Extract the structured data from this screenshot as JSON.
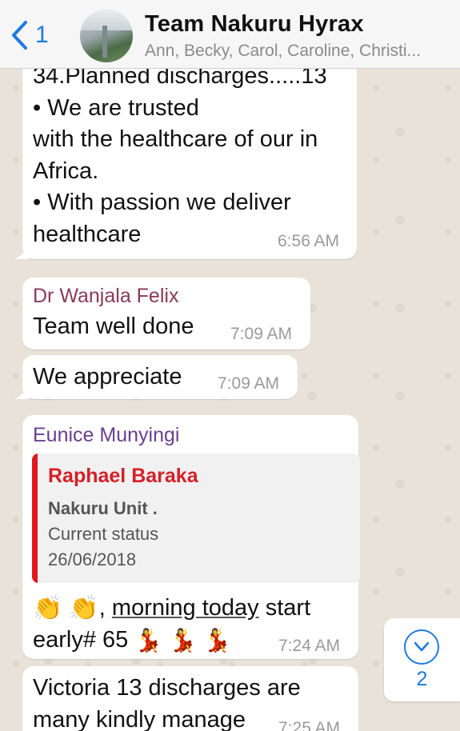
{
  "header": {
    "back_count": "1",
    "title": "Team Nakuru Hyrax",
    "subtitle": "Ann, Becky, Carol, Caroline, Christi..."
  },
  "messages": [
    {
      "lines": [
        "34.Planned discharges.....13",
        "• We are trusted",
        "with the healthcare of our in",
        "Africa.",
        "• With passion we deliver",
        "healthcare"
      ],
      "time": "6:56 AM"
    },
    {
      "sender": "Dr Wanjala Felix",
      "sender_color": "#8b3a54",
      "text": "Team well done",
      "time": "7:09 AM"
    },
    {
      "text": "We appreciate",
      "time": "7:09 AM"
    },
    {
      "sender": "Eunice Munyingi",
      "sender_color": "#6b3f8f",
      "quote": {
        "name": "Raphael Baraka",
        "lines": [
          "Nakuru Unit .",
          "Current status",
          "26/06/2018"
        ]
      },
      "emoji_clap": "👏",
      "text_a": ", ",
      "text_underlined": "morning today",
      "text_b": " start",
      "text_line2": "early# 65 ",
      "emoji_dancer": "💃",
      "time": "7:24 AM"
    },
    {
      "lines": [
        "Victoria 13 discharges are",
        "many kindly manage"
      ],
      "time": "7:25 AM"
    }
  ],
  "scroll_button": {
    "icon": "chevron-down-icon",
    "unread": "2"
  },
  "colors": {
    "accent": "#1f7ae0",
    "quote_bar": "#e0171e",
    "quote_name": "#d51f26"
  }
}
